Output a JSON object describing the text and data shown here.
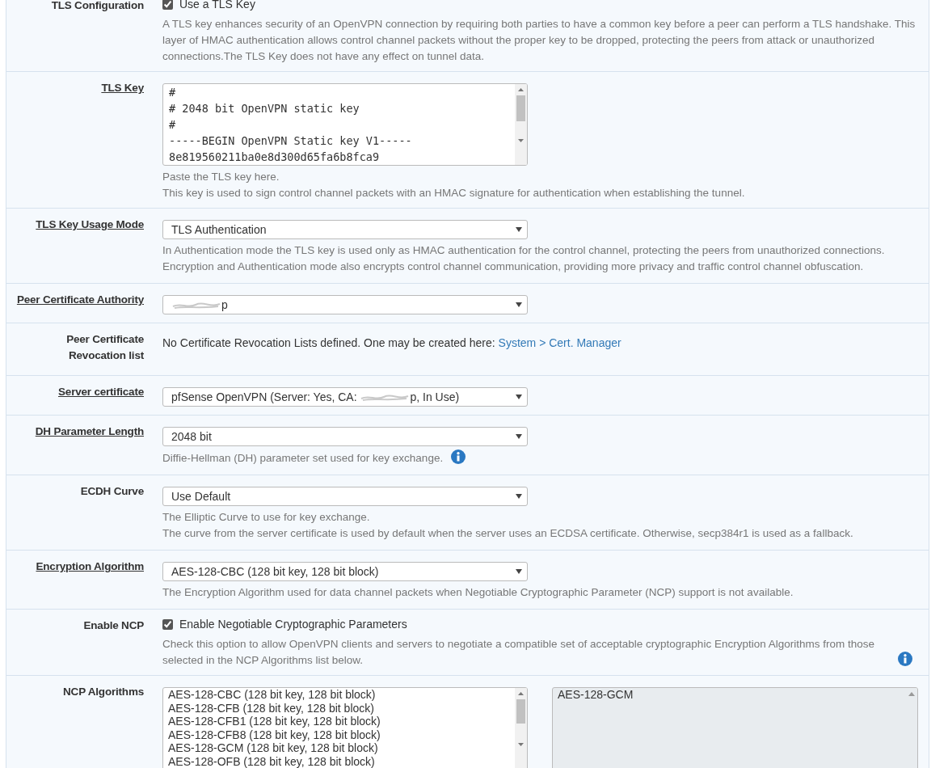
{
  "rows": [
    {
      "kind": "checkbox",
      "label": "TLS Configuration",
      "underlined": false,
      "checkbox": {
        "label": "Use a TLS Key",
        "checked": true
      },
      "help": [
        "A TLS key enhances security of an OpenVPN connection by requiring both parties to have a common key before a peer can perform a TLS handshake. This layer of HMAC authentication allows control channel packets without the proper key to be dropped, protecting the peers from attack or unauthorized connections.The TLS Key does not have any effect on tunnel data."
      ]
    },
    {
      "kind": "textarea",
      "label": "TLS Key",
      "underlined": true,
      "lines": [
        "#",
        "# 2048 bit OpenVPN static key",
        "#",
        "-----BEGIN OpenVPN Static key V1-----",
        "8e819560211ba0e8d300d65fa6b8fca9"
      ],
      "help": [
        "Paste the TLS key here.",
        "This key is used to sign control channel packets with an HMAC signature for authentication when establishing the tunnel."
      ]
    },
    {
      "kind": "select",
      "label": "TLS Key Usage Mode",
      "underlined": true,
      "value": [
        {
          "kind": "text",
          "text": "TLS Authentication"
        }
      ],
      "help": [
        "In Authentication mode the TLS key is used only as HMAC authentication for the control channel, protecting the peers from unauthorized connections.",
        "Encryption and Authentication mode also encrypts control channel communication, providing more privacy and traffic control channel obfuscation."
      ]
    },
    {
      "kind": "select",
      "label": "Peer Certificate Authority",
      "underlined": true,
      "value": [
        {
          "kind": "redacted"
        },
        {
          "kind": "text",
          "text": "p"
        }
      ]
    },
    {
      "kind": "text",
      "label": "Peer Certificate Revocation list",
      "underlined": false,
      "text": "No Certificate Revocation Lists defined. One may be created here: ",
      "link": "System > Cert. Manager"
    },
    {
      "kind": "select",
      "label": "Server certificate",
      "underlined": true,
      "value": [
        {
          "kind": "text",
          "text": "pfSense OpenVPN (Server: Yes, CA: "
        },
        {
          "kind": "redacted"
        },
        {
          "kind": "text",
          "text": "p, In Use)"
        }
      ]
    },
    {
      "kind": "select",
      "label": "DH Parameter Length",
      "underlined": true,
      "value": [
        {
          "kind": "text",
          "text": "2048 bit"
        }
      ],
      "help": [
        "Diffie-Hellman (DH) parameter set used for key exchange."
      ],
      "info_icon": true
    },
    {
      "kind": "select",
      "label": "ECDH Curve",
      "underlined": false,
      "value": [
        {
          "kind": "text",
          "text": "Use Default"
        }
      ],
      "help": [
        "The Elliptic Curve to use for key exchange.",
        "The curve from the server certificate is used by default when the server uses an ECDSA certificate. Otherwise, secp384r1 is used as a fallback."
      ]
    },
    {
      "kind": "select",
      "label": "Encryption Algorithm",
      "underlined": true,
      "value": [
        {
          "kind": "text",
          "text": "AES-128-CBC (128 bit key, 128 bit block)"
        }
      ],
      "help": [
        "The Encryption Algorithm used for data channel packets when Negotiable Cryptographic Parameter (NCP) support is not available."
      ]
    },
    {
      "kind": "checkbox",
      "label": "Enable NCP",
      "underlined": false,
      "checkbox": {
        "label": "Enable Negotiable Cryptographic Parameters",
        "checked": true
      },
      "help": [
        "Check this option to allow OpenVPN clients and servers to negotiate a compatible set of acceptable cryptographic Encryption Algorithms from those selected in the NCP Algorithms list below."
      ],
      "info_icon": true
    },
    {
      "kind": "listboxes",
      "label": "NCP Algorithms",
      "underlined": false,
      "available": [
        "AES-128-CBC (128 bit key, 128 bit block)",
        "AES-128-CFB (128 bit key, 128 bit block)",
        "AES-128-CFB1 (128 bit key, 128 bit block)",
        "AES-128-CFB8 (128 bit key, 128 bit block)",
        "AES-128-GCM (128 bit key, 128 bit block)",
        "AES-128-OFB (128 bit key, 128 bit block)"
      ],
      "chosen": [
        "AES-128-GCM"
      ]
    }
  ]
}
